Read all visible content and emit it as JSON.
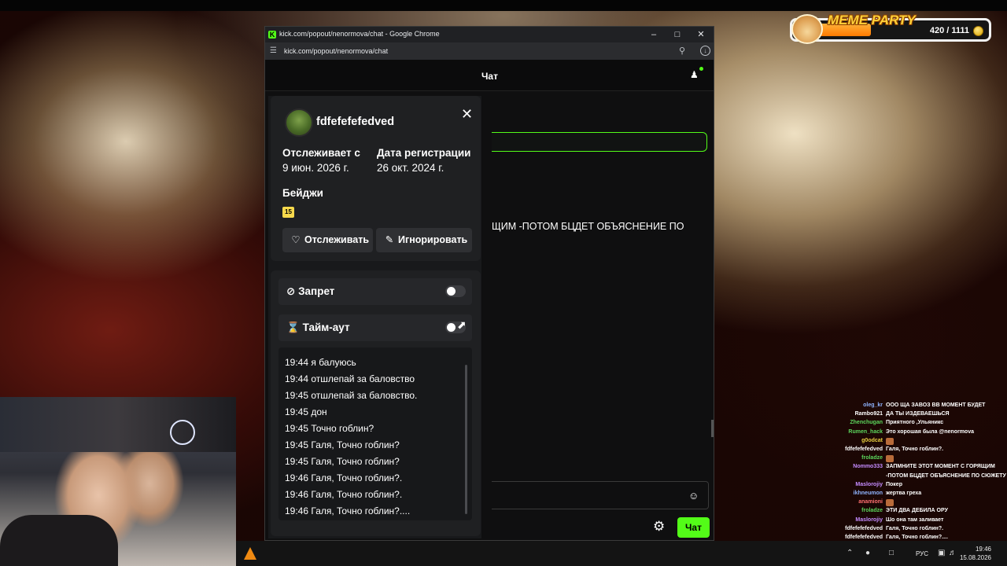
{
  "meme_widget": {
    "title": "MEME PARTY",
    "score": "420 / 1111",
    "progress": 0.38
  },
  "browser": {
    "window_title": "kick.com/popout/nenormova/chat - Google Chrome",
    "url": "kick.com/popout/nenormova/chat",
    "favicon": "K"
  },
  "chat": {
    "header_title": "Чат",
    "visible_message": "ЩИМ -ПОТОМ БЦДЕТ ОБЪЯСНЕНИЕ ПО",
    "send_label": "Чат",
    "accent": "#53fc18"
  },
  "user_card": {
    "username": "fdfefefefedved",
    "following_label": "Отслеживает с",
    "following_date": "9 июн. 2026 г.",
    "registered_label": "Дата регистрации",
    "registered_date": "26 окт. 2024 г.",
    "badges_label": "Бейджи",
    "badge_value": "15",
    "follow_button": "Отслеживать",
    "ignore_button": "Игнорировать",
    "ban_label": "Запрет",
    "timeout_label": "Тайм-аут",
    "history": [
      "19:44 я балуюсь",
      "19:44 отшлепай за баловство",
      "19:45 отшлепай за баловство.",
      "19:45 дон",
      "19:45 Точно гоблин?",
      "19:45 Галя, Точно гоблин?",
      "19:45 Галя, Точно гоблин?",
      "19:46 Галя, Точно гоблин?.",
      "19:46 Галя, Точно гоблин?.",
      "19:46 Галя, Точно гоблин?...."
    ]
  },
  "overlay_chat": [
    {
      "user": "oleg_kr",
      "color": "#8fb3ff",
      "msg": "ООО ЩА ЗАВОЗ ВВ МОМЕНТ БУДЕТ"
    },
    {
      "user": "Rambo921",
      "color": "#ffffff",
      "msg": "ДА ТЫ ИЗДЕВАЕШЬСЯ"
    },
    {
      "user": "Zhenchugan",
      "color": "#5cd65c",
      "msg": "Приятного ,Ульяникс"
    },
    {
      "user": "Rumen_hack",
      "color": "#5cd65c",
      "msg": "Это хорошая была @nenormova"
    },
    {
      "user": "g0odcat",
      "color": "#e8d040",
      "msg": ""
    },
    {
      "user": "fdfefefefedved",
      "color": "#ffffff",
      "msg": "Галя, Точно гоблин?."
    },
    {
      "user": "froladze",
      "color": "#5cd65c",
      "msg": ""
    },
    {
      "user": "Nommo333",
      "color": "#c58cff",
      "msg": "ЗАПМНИТЕ ЭТОТ МОМЕНТ С ГОРЯЩИМ"
    },
    {
      "user": "",
      "color": "#ffffff",
      "msg": "-ПОТОМ БЦДЕТ ОБЪЯСНЕНИЕ ПО СЮЖЕТУ"
    },
    {
      "user": "Maslorojiy",
      "color": "#c58cff",
      "msg": "Покер"
    },
    {
      "user": "ikhneumon",
      "color": "#8fb3ff",
      "msg": "жертва греха"
    },
    {
      "user": "anamioni",
      "color": "#ff7070",
      "msg": ""
    },
    {
      "user": "froladze",
      "color": "#5cd65c",
      "msg": "ЭТИ ДВА ДЕБИЛА ОРУ"
    },
    {
      "user": "Maslorojiy",
      "color": "#c58cff",
      "msg": "Шо она там заливает"
    },
    {
      "user": "fdfefefefedved",
      "color": "#ffffff",
      "msg": "Галя, Точно гоблин?."
    },
    {
      "user": "fdfefefefedved",
      "color": "#ffffff",
      "msg": "Галя, Точно гоблин?...."
    }
  ],
  "taskbar": {
    "lang": "РУС",
    "time": "19:46",
    "date": "15.08.2026"
  }
}
